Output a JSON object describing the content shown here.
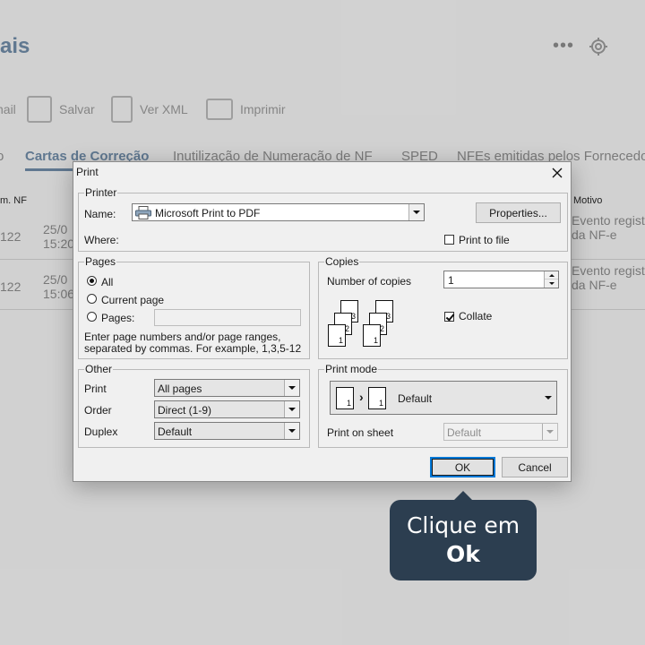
{
  "background": {
    "title": "ais",
    "more_label": "•••",
    "toolbar": [
      {
        "label": "nail",
        "icon": "email-icon"
      },
      {
        "label": "Salvar",
        "icon": "save-icon"
      },
      {
        "label": "Ver XML",
        "icon": "document-search-icon"
      },
      {
        "label": "Imprimir",
        "icon": "printer-icon"
      }
    ],
    "tabs": [
      "o",
      "Cartas de Correção",
      "Inutilização de Numeração de NF",
      "SPED",
      "NFEs emitidas pelos Fornecedores"
    ],
    "table": {
      "header_left": "m. NF",
      "header_right": "Motivo",
      "rows": [
        {
          "num": "122",
          "date_line1": "25/0",
          "date_line2": "15:20",
          "motivo_line1": "Evento regist",
          "motivo_line2": "da NF-e"
        },
        {
          "num": "122",
          "date_line1": "25/0",
          "date_line2": "15:06",
          "motivo_line1": "Evento regist",
          "motivo_line2": "da NF-e"
        }
      ]
    }
  },
  "dialog": {
    "title": "Print",
    "printer": {
      "group_label": "Printer",
      "name_label": "Name:",
      "name_value": "Microsoft Print to PDF",
      "properties_button": "Properties...",
      "where_label": "Where:",
      "print_to_file_label": "Print to file",
      "print_to_file_checked": false
    },
    "pages": {
      "group_label": "Pages",
      "all_label": "All",
      "current_page_label": "Current page",
      "pages_label": "Pages:",
      "pages_value": "",
      "selected": "all",
      "help_line1": "Enter page numbers and/or page ranges,",
      "help_line2": "separated by commas. For example, 1,3,5-12"
    },
    "copies": {
      "group_label": "Copies",
      "number_label": "Number of copies",
      "number_value": "1",
      "collate_label": "Collate",
      "collate_checked": true,
      "stack_labels": [
        "3",
        "2",
        "1"
      ]
    },
    "other": {
      "group_label": "Other",
      "print_label": "Print",
      "print_value": "All pages",
      "order_label": "Order",
      "order_value": "Direct (1-9)",
      "duplex_label": "Duplex",
      "duplex_value": "Default"
    },
    "print_mode": {
      "group_label": "Print mode",
      "mode_value": "Default",
      "page_labels": [
        "1",
        "1"
      ],
      "arrow_glyph": "›",
      "print_on_sheet_label": "Print on sheet",
      "print_on_sheet_value": "Default"
    },
    "ok_button": "OK",
    "cancel_button": "Cancel"
  },
  "callout": {
    "line1": "Clique em",
    "line2": "Ok",
    "bg_color": "#2c3e50"
  }
}
